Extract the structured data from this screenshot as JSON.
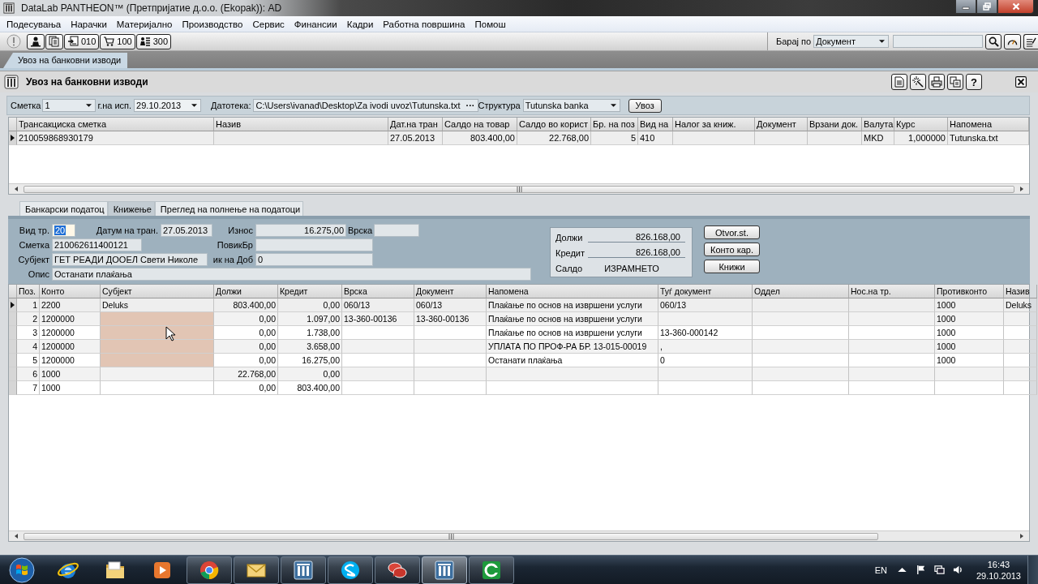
{
  "window": {
    "title": "DataLab PANTHEON™ (Претпријатие д.о.о. (Ekopak)): AD"
  },
  "menu": [
    "Подесувања",
    "Нарачки",
    "Материјално",
    "Производство",
    "Сервис",
    "Финансии",
    "Кадри",
    "Работна површина",
    "Помош"
  ],
  "toolbar": {
    "buttons": [
      {
        "kind": "user"
      },
      {
        "kind": "documents"
      },
      {
        "kind": "import",
        "label": "010"
      },
      {
        "kind": "cart",
        "label": "100"
      },
      {
        "kind": "staff",
        "label": "300"
      }
    ],
    "search_by_label": "Барај по",
    "search_by_value": "Документ"
  },
  "document_tabs": [
    {
      "label": "Увоз на банковни изводи",
      "selected": true
    }
  ],
  "form": {
    "title": "Увоз на банковни изводи",
    "buttons": [
      {
        "kind": "document"
      },
      {
        "kind": "wand"
      },
      {
        "kind": "printer"
      },
      {
        "kind": "copy"
      },
      {
        "kind": "help",
        "label": "?"
      }
    ]
  },
  "params": {
    "account_label": "Сметка",
    "account_value": "1",
    "date_label": "г.на исп.",
    "date_value": "29.10.2013",
    "file_label": "Датотека:",
    "file_value": "C:\\Users\\ivanad\\Desktop\\Za ivodi uvoz\\Tutunska.txt",
    "browse_button": "···",
    "structure_label": "Структура",
    "structure_value": "Tutunska banka",
    "import_button": "Увоз"
  },
  "statements": {
    "columns": [
      "Трансакциска сметка",
      "Назив",
      "Дат.на тран",
      "Салдо на товар",
      "Салдо во корист",
      "Бр. на поз",
      "Вид на",
      "Налог за книж.",
      "Документ",
      "Врзани док.",
      "Валута",
      "Курс",
      "Напомена"
    ],
    "rows": [
      {
        "selected": true,
        "cells": [
          "210059868930179",
          null,
          "27.05.2013",
          "803.400,00",
          "22.768,00",
          "5",
          "410",
          null,
          null,
          null,
          "MKD",
          "1,000000",
          "Tutunska.txt"
        ]
      }
    ]
  },
  "detail_tabs": [
    {
      "label": "Банкарски податоц",
      "selected": false
    },
    {
      "label": "Книжење",
      "selected": true
    },
    {
      "label": "Преглед на полнење на податоци",
      "selected": false
    }
  ],
  "posting": {
    "transaction_type": {
      "label": "Вид тр.",
      "value": "20",
      "highlighted": true
    },
    "transaction_date": {
      "label": "Датум на тран.",
      "value": "27.05.2013"
    },
    "amount": {
      "label": "Износ",
      "value": "16.275,00"
    },
    "link": {
      "label": "Врска"
    },
    "account": {
      "label": "Сметка",
      "value": "210062611400121"
    },
    "reference": {
      "label": "ПовикБр"
    },
    "subject": {
      "label": "Субјект",
      "value": "ГЕТ РЕАДИ ДООЕЛ Свети Николе"
    },
    "field_9": {
      "label": "ик на Доб",
      "value": "0"
    },
    "description": {
      "label": "Опис",
      "value": "Останати плаќања"
    },
    "totals": [
      {
        "label": "Должи",
        "value": "826.168,00"
      },
      {
        "label": "Кредит",
        "value": "826.168,00"
      },
      {
        "label": "Салдо",
        "value": "ИЗРАМНЕТО"
      }
    ],
    "buttons": [
      "Otvor.st.",
      "Конто кар.",
      "Книжи"
    ]
  },
  "postings": {
    "columns": [
      "Поз.",
      "Конто",
      "Субјект",
      "Должи",
      "Кредит",
      "Врска",
      "Документ",
      "Напомена",
      "Туѓ документ",
      "Оддел",
      "Нос.на тр.",
      "Противконто",
      "Назив"
    ],
    "rows": [
      {
        "selected": true,
        "flagged": false,
        "cells": [
          "1",
          "2200",
          "Deluks",
          "803.400,00",
          "0,00",
          "060/13",
          "060/13",
          "Плаќање по основ на извршени услуги",
          "060/13",
          null,
          null,
          "1000",
          "Deluks"
        ]
      },
      {
        "selected": false,
        "flagged": true,
        "cells": [
          "2",
          "1200000",
          null,
          "0,00",
          "1.097,00",
          "13-360-00136",
          "13-360-00136",
          "Плаќање по основ на извршени услуги",
          null,
          null,
          null,
          "1000",
          null
        ]
      },
      {
        "selected": false,
        "flagged": true,
        "cells": [
          "3",
          "1200000",
          null,
          "0,00",
          "1.738,00",
          null,
          null,
          "Плаќање по основ на извршени услуги",
          "13-360-000142",
          null,
          null,
          "1000",
          null
        ]
      },
      {
        "selected": false,
        "flagged": true,
        "cells": [
          "4",
          "1200000",
          null,
          "0,00",
          "3.658,00",
          null,
          null,
          "УПЛАТА ПО ПРОФ-РА БР. 13-015-00019",
          ",",
          null,
          null,
          "1000",
          null
        ]
      },
      {
        "selected": false,
        "flagged": true,
        "cells": [
          "5",
          "1200000",
          null,
          "0,00",
          "16.275,00",
          null,
          null,
          "Останати плаќања",
          "0",
          null,
          null,
          "1000",
          null
        ]
      },
      {
        "selected": false,
        "flagged": false,
        "cells": [
          "6",
          "1000",
          null,
          "22.768,00",
          "0,00",
          null,
          null,
          null,
          null,
          null,
          null,
          null,
          null
        ]
      },
      {
        "selected": false,
        "flagged": false,
        "cells": [
          "7",
          "1000",
          null,
          "0,00",
          "803.400,00",
          null,
          null,
          null,
          null,
          null,
          null,
          null,
          null
        ]
      }
    ]
  },
  "taskbar": {
    "apps": [
      {
        "kind": "ie",
        "running": false,
        "selected": false
      },
      {
        "kind": "folder",
        "running": false,
        "selected": false
      },
      {
        "kind": "player",
        "running": false,
        "selected": false
      },
      {
        "kind": "chrome",
        "running": true,
        "selected": false
      },
      {
        "kind": "mail",
        "running": true,
        "selected": false
      },
      {
        "kind": "pantheon",
        "running": true,
        "selected": false
      },
      {
        "kind": "skype",
        "running": true,
        "selected": false
      },
      {
        "kind": "chat",
        "running": true,
        "selected": false
      },
      {
        "kind": "pantheon",
        "running": true,
        "selected": true
      },
      {
        "kind": "ring",
        "running": true,
        "selected": false
      }
    ],
    "language": "EN",
    "time": "16:43",
    "date": "29.10.2013"
  }
}
